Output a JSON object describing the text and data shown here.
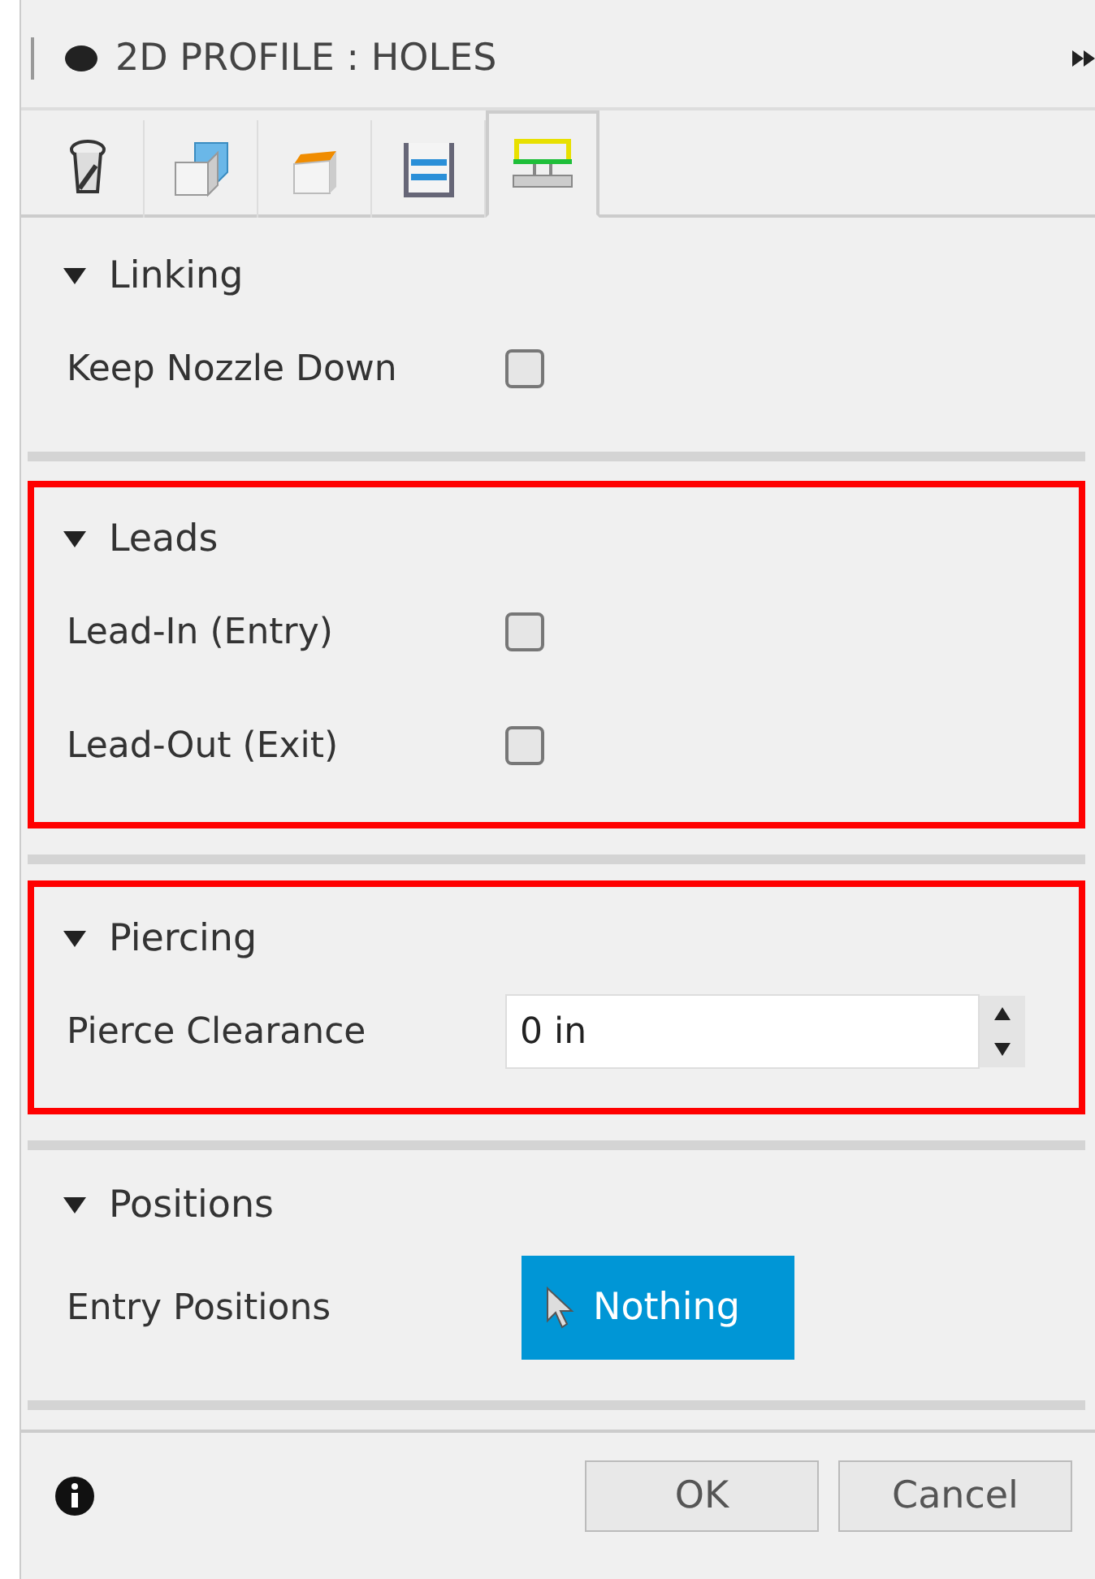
{
  "panel": {
    "title": "2D PROFILE : HOLES"
  },
  "tabs": [
    {
      "kind": "tool",
      "selected": false
    },
    {
      "kind": "geometry",
      "selected": false
    },
    {
      "kind": "heights",
      "selected": false
    },
    {
      "kind": "passes",
      "selected": false
    },
    {
      "kind": "linking",
      "selected": true
    }
  ],
  "sections": [
    {
      "title": "Linking",
      "expanded": true,
      "highlighted": false,
      "rows": [
        {
          "kind": "checkbox",
          "label": "Keep Nozzle Down",
          "checked": false
        }
      ]
    },
    {
      "title": "Leads",
      "expanded": true,
      "highlighted": true,
      "rows": [
        {
          "kind": "checkbox",
          "label": "Lead-In (Entry)",
          "checked": false
        },
        {
          "kind": "checkbox",
          "label": "Lead-Out (Exit)",
          "checked": false
        }
      ]
    },
    {
      "title": "Piercing",
      "expanded": true,
      "highlighted": true,
      "rows": [
        {
          "kind": "number",
          "label": "Pierce Clearance",
          "value": "0 in"
        }
      ]
    },
    {
      "title": "Positions",
      "expanded": true,
      "highlighted": false,
      "rows": [
        {
          "kind": "selection",
          "label": "Entry Positions",
          "value": "Nothing"
        }
      ]
    }
  ],
  "buttons": [
    "OK",
    "Cancel"
  ]
}
